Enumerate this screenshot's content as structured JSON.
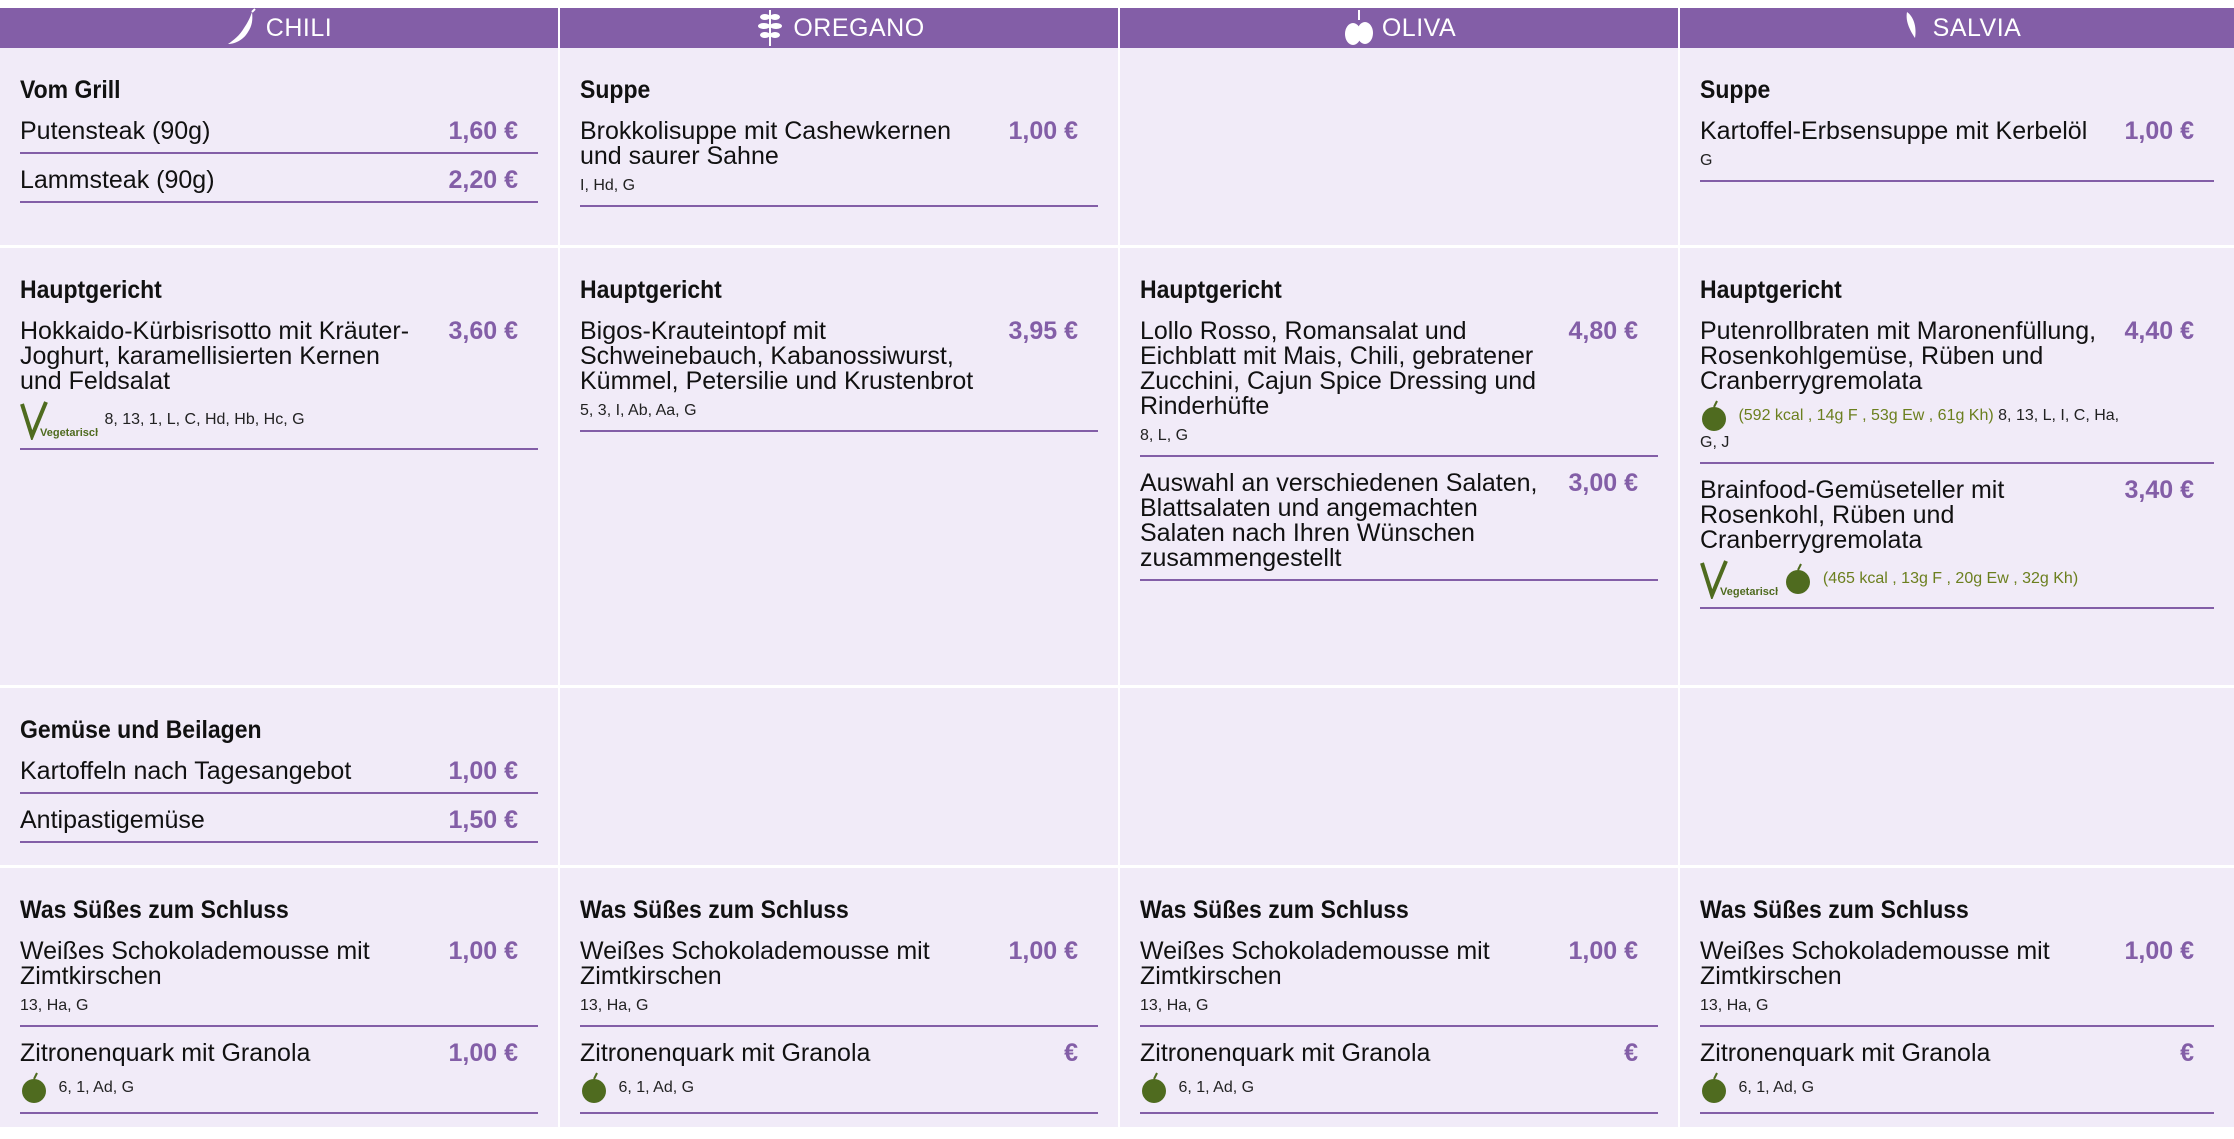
{
  "colors": {
    "accent": "#835ea7",
    "cell_bg": "#f1ebf8",
    "badge_green": "#4f6b1f"
  },
  "columns": [
    {
      "name": "CHILI",
      "icon": "chili-pepper-icon"
    },
    {
      "name": "OREGANO",
      "icon": "oregano-sprig-icon"
    },
    {
      "name": "OLIVA",
      "icon": "olive-icon"
    },
    {
      "name": "SALVIA",
      "icon": "sage-leaf-icon"
    }
  ],
  "chili": {
    "grill": {
      "title": "Vom Grill",
      "items": [
        {
          "name": "Putensteak (90g)",
          "price": "1,60 €"
        },
        {
          "name": "Lammsteak (90g)",
          "price": "2,20 €"
        }
      ]
    },
    "main": {
      "title": "Hauptgericht",
      "items": [
        {
          "name": "Hokkaido-Kürbisrisotto mit Kräuter-Joghurt, karamellisierten Kernen und Feldsalat",
          "price": "3,60 €",
          "allergens": "8, 13, 1, L, C, Hd, Hb, Hc, G",
          "badge": "Vegetarisch"
        }
      ]
    },
    "sides": {
      "title": "Gemüse und Beilagen",
      "items": [
        {
          "name": "Kartoffeln nach Tagesangebot",
          "price": "1,00 €"
        },
        {
          "name": "Antipastigemüse",
          "price": "1,50 €"
        }
      ]
    },
    "dessert": {
      "title": "Was Süßes zum Schluss",
      "items": [
        {
          "name": "Weißes Schokolademousse mit Zimtkirschen",
          "price": "1,00 €",
          "allergens": "13, Ha, G"
        },
        {
          "name": "Zitronenquark mit Granola",
          "price": "1,00 €",
          "allergens": "6, 1, Ad, G"
        }
      ]
    }
  },
  "oregano": {
    "soup": {
      "title": "Suppe",
      "items": [
        {
          "name": "Brokkolisuppe mit Cashewkernen und saurer Sahne",
          "price": "1,00 €",
          "allergens": "I, Hd, G"
        }
      ]
    },
    "main": {
      "title": "Hauptgericht",
      "items": [
        {
          "name": "Bigos-Krauteintopf mit Schweinebauch, Kabanossiwurst, Kümmel, Petersilie und Krustenbrot",
          "price": "3,95 €",
          "allergens": "5, 3, I, Ab, Aa, G"
        }
      ]
    },
    "dessert": {
      "title": "Was Süßes zum Schluss",
      "items": [
        {
          "name": "Weißes Schokolademousse mit Zimtkirschen",
          "price": "1,00 €",
          "allergens": "13, Ha, G"
        },
        {
          "name": "Zitronenquark mit Granola",
          "price": "€",
          "allergens": "6, 1, Ad, G"
        }
      ]
    }
  },
  "oliva": {
    "main": {
      "title": "Hauptgericht",
      "items": [
        {
          "name": "Lollo Rosso, Romansalat und Eichblatt mit Mais, Chili, gebratener Zucchini, Cajun Spice Dressing und Rinderhüfte",
          "price": "4,80 €",
          "allergens": "8, L, G"
        },
        {
          "name": "Auswahl an verschiedenen Salaten, Blattsalaten und angemachten Salaten nach Ihren Wünschen zusammengestellt",
          "price": "3,00 €"
        }
      ]
    },
    "dessert": {
      "title": "Was Süßes zum Schluss",
      "items": [
        {
          "name": "Weißes Schokolademousse mit Zimtkirschen",
          "price": "1,00 €",
          "allergens": "13, Ha, G"
        },
        {
          "name": "Zitronenquark mit Granola",
          "price": "€",
          "allergens": "6, 1, Ad, G"
        }
      ]
    }
  },
  "salvia": {
    "soup": {
      "title": "Suppe",
      "items": [
        {
          "name": "Kartoffel-Erbsensuppe mit Kerbelöl",
          "price": "1,00 €",
          "allergens": "G"
        }
      ]
    },
    "main": {
      "title": "Hauptgericht",
      "items": [
        {
          "name": "Putenrollbraten mit Maronenfüllung, Rosenkohlgemüse, Rüben und Cranberrygremolata",
          "price": "4,40 €",
          "nutrition": "(592 kcal , 14g F , 53g Ew , 61g Kh)",
          "allergens": "8, 13, L, I, C, Ha, G, J"
        },
        {
          "name": "Brainfood-Gemüseteller mit Rosenkohl, Rüben und Cranberrygremolata",
          "price": "3,40 €",
          "badge": "Vegetarisch",
          "nutrition": "(465 kcal , 13g F , 20g Ew , 32g Kh)"
        }
      ]
    },
    "dessert": {
      "title": "Was Süßes zum Schluss",
      "items": [
        {
          "name": "Weißes Schokolademousse mit Zimtkirschen",
          "price": "1,00 €",
          "allergens": "13, Ha, G"
        },
        {
          "name": "Zitronenquark mit Granola",
          "price": "€",
          "allergens": "6, 1, Ad, G"
        }
      ]
    }
  }
}
